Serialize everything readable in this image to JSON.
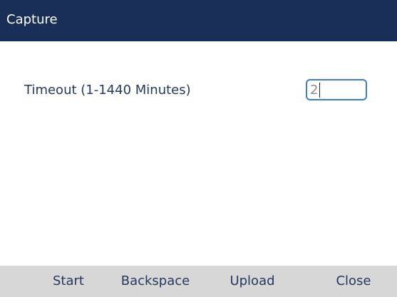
{
  "screen": {
    "title": "Capture"
  },
  "form": {
    "timeout_label": "Timeout (1-1440 Minutes)",
    "timeout_value": "2"
  },
  "softkeys": [
    {
      "label": "Start"
    },
    {
      "label": "Backspace"
    },
    {
      "label": "Upload"
    },
    {
      "label": "Close"
    }
  ],
  "colors": {
    "title_bar": "#1a2f57",
    "accent": "#3b7dd8",
    "label_text": "#26385e",
    "softkey_bar": "#d7d7d7"
  }
}
